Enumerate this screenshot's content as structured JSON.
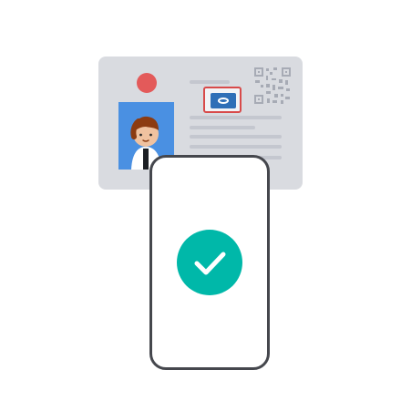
{
  "illustration": {
    "card_bg": "#d9dbe0",
    "photo_bg": "#4a90e2",
    "chip_bg": "#2f6fb7",
    "chip_border": "#d84a4a",
    "phone_border": "#45474d",
    "check_color": "#00b8a9",
    "icon_names": [
      "id-card-icon",
      "person-photo-icon",
      "chip-icon",
      "qr-code-icon",
      "smartphone-icon",
      "check-icon"
    ]
  }
}
